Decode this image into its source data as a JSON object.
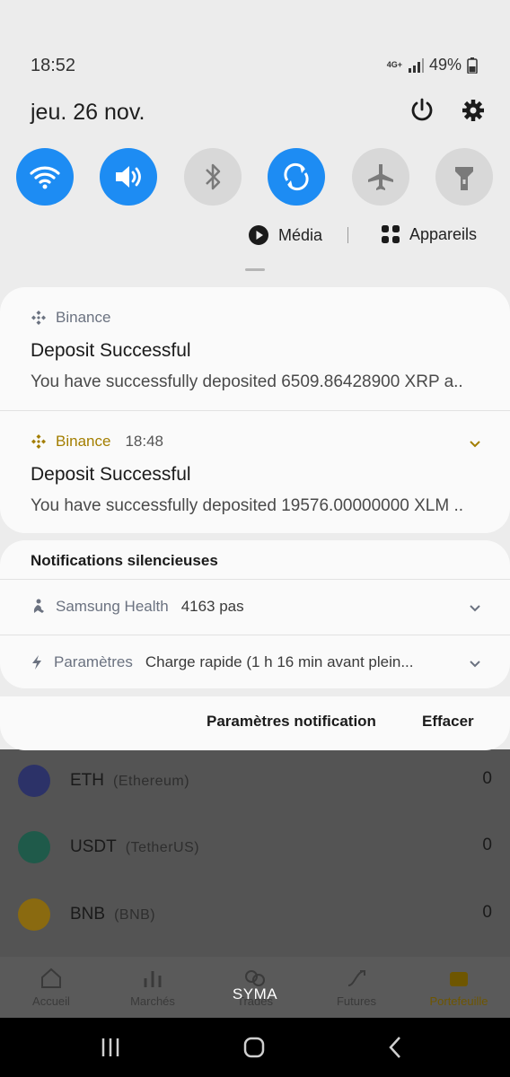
{
  "status_bar": {
    "time": "18:52",
    "network": "4G+",
    "battery": "49%"
  },
  "quick_panel": {
    "date": "jeu. 26 nov.",
    "media_label": "Média",
    "devices_label": "Appareils"
  },
  "notifications": [
    {
      "app": "Binance",
      "time": "",
      "title": "Deposit Successful",
      "text": "You have successfully deposited 6509.86428900 XRP a.."
    },
    {
      "app": "Binance",
      "time": "18:48",
      "title": "Deposit Successful",
      "text": "You have successfully deposited 19576.00000000 XLM .."
    }
  ],
  "silent": {
    "header": "Notifications silencieuses",
    "items": [
      {
        "app": "Samsung Health",
        "text": "4163 pas"
      },
      {
        "app": "Paramètres",
        "text": "Charge rapide (1 h 16 min avant plein..."
      }
    ]
  },
  "footer": {
    "settings_label": "Paramètres notification",
    "clear_label": "Effacer"
  },
  "app": {
    "assets": [
      {
        "symbol": "ETH",
        "name": "(Ethereum)",
        "value": "0",
        "color": "#2c3268"
      },
      {
        "symbol": "USDT",
        "name": "(TetherUS)",
        "value": "0",
        "color": "#1f5a4a"
      },
      {
        "symbol": "BNB",
        "name": "(BNB)",
        "value": "0",
        "color": "#8a6a10"
      }
    ],
    "nav": [
      "Accueil",
      "Marchés",
      "Trades",
      "Futures",
      "Portefeuille"
    ],
    "overlay_text": "SYMA"
  },
  "colors": {
    "accent": "#1d8cf3",
    "binance_gold": "#a37e00",
    "muted_icon": "#6b6b6b"
  }
}
